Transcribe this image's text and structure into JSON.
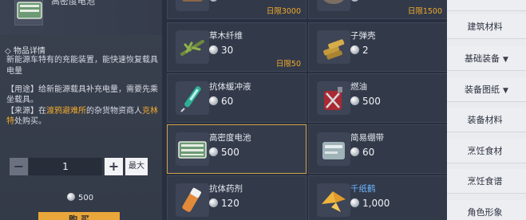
{
  "detail": {
    "item_name": "高密度电池",
    "info_title": "◇ 物品详情",
    "description": "新能源车特有的充能装置，能快速恢复载具电量",
    "usage_prefix": "【用途】",
    "usage_text": "给新能源载具补充电量，需要先乘坐载具。",
    "source_prefix": "【来源】",
    "source_text_1": "在",
    "source_place": "渡鸦避难所",
    "source_text_2": "的杂货物资商人",
    "source_npc": "克林特",
    "source_text_3": "处购买。",
    "quantity": "1",
    "minus_label": "−",
    "plus_label": "+",
    "max_label": "最大",
    "price": "500",
    "buy_label": "购 买"
  },
  "items": [
    {
      "name": "",
      "price": "",
      "limit": "日限3000",
      "icon": "wood-icon"
    },
    {
      "name": "",
      "price": "",
      "limit": "日限1500",
      "icon": "stone-icon"
    },
    {
      "name": "草木纤维",
      "price": "30",
      "limit": "日限50",
      "icon": "plant-fiber-icon"
    },
    {
      "name": "子弹壳",
      "price": "2",
      "limit": "",
      "icon": "bullet-casing-icon"
    },
    {
      "name": "抗体缓冲液",
      "price": "60",
      "limit": "",
      "icon": "syringe-icon"
    },
    {
      "name": "燃油",
      "price": "500",
      "limit": "",
      "icon": "fuel-can-icon"
    },
    {
      "name": "高密度电池",
      "price": "500",
      "limit": "",
      "icon": "battery-icon"
    },
    {
      "name": "简易绷带",
      "price": "60",
      "limit": "",
      "icon": "bandage-icon"
    },
    {
      "name": "抗体药剂",
      "price": "120",
      "limit": "",
      "icon": "medicine-icon"
    },
    {
      "name": "千纸鹤",
      "price": "1,000",
      "limit": "",
      "icon": "paper-crane-icon"
    }
  ],
  "categories": [
    {
      "label": "建筑材料",
      "arrow": ""
    },
    {
      "label": "基础装备",
      "arrow": "▼"
    },
    {
      "label": "装备图纸",
      "arrow": "▼"
    },
    {
      "label": "装备材料",
      "arrow": ""
    },
    {
      "label": "烹饪食材",
      "arrow": ""
    },
    {
      "label": "烹饪食谱",
      "arrow": ""
    },
    {
      "label": "角色形象",
      "arrow": ""
    }
  ],
  "colors": {
    "accent_gold": "#f0a92a",
    "highlight_blue": "#6fb6ff",
    "selected_border": "#d4a34a"
  }
}
